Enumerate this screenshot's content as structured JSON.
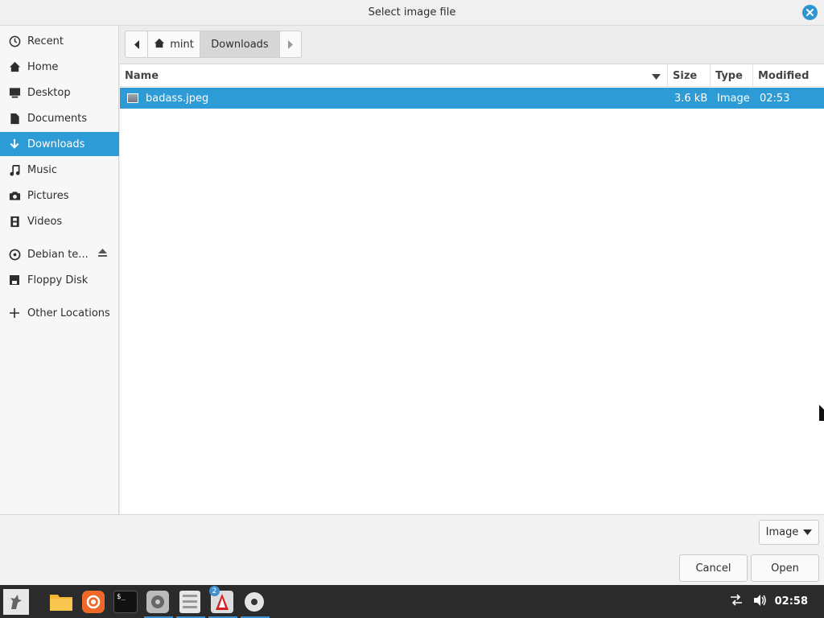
{
  "window": {
    "title": "Select image file"
  },
  "sidebar": {
    "items": [
      {
        "label": "Recent",
        "icon": "clock-icon"
      },
      {
        "label": "Home",
        "icon": "home-icon"
      },
      {
        "label": "Desktop",
        "icon": "desktop-icon"
      },
      {
        "label": "Documents",
        "icon": "documents-icon"
      },
      {
        "label": "Downloads",
        "icon": "download-icon",
        "active": true
      },
      {
        "label": "Music",
        "icon": "music-icon"
      },
      {
        "label": "Pictures",
        "icon": "camera-icon"
      },
      {
        "label": "Videos",
        "icon": "film-icon"
      },
      {
        "label": "Debian te...",
        "icon": "disc-icon"
      },
      {
        "label": "Floppy Disk",
        "icon": "floppy-icon"
      },
      {
        "label": "Other Locations",
        "icon": "plus-icon"
      }
    ]
  },
  "pathbar": {
    "segments": [
      "mint",
      "Downloads"
    ]
  },
  "file_list": {
    "columns": [
      "Name",
      "Size",
      "Type",
      "Modified"
    ],
    "rows": [
      {
        "name": "badass.jpeg",
        "size": "3.6 kB",
        "type": "Image",
        "modified": "02:53"
      }
    ]
  },
  "bottom": {
    "filter": "Image",
    "cancel_label": "Cancel",
    "open_label": "Open"
  },
  "taskbar": {
    "clock": "02:58",
    "badge_count": "2",
    "apps": [
      "menu-icon",
      "files-icon",
      "firefox-icon",
      "terminal-icon",
      "disks-icon",
      "text-editor-icon",
      "inkscape-icon",
      "disc-icon"
    ]
  },
  "colors": {
    "accent": "#2d9bd6",
    "close": "#2e94d2",
    "taskbar": "#2b2b2b"
  }
}
